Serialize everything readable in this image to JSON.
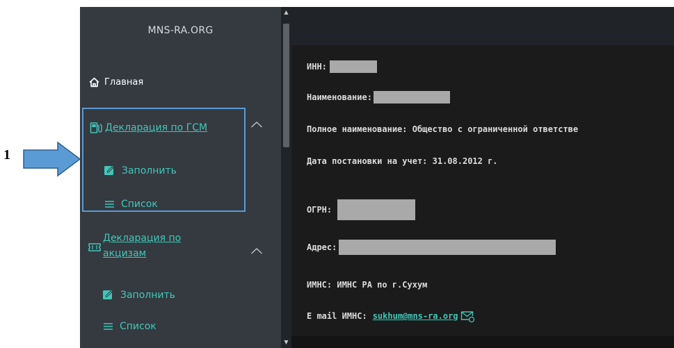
{
  "annotation": {
    "number": "1"
  },
  "sidebar": {
    "logo": "MNS-RA.ORG",
    "home_label": "Главная",
    "gsm": {
      "label": "Декларация по ГСМ",
      "fill_label": "Заполнить",
      "list_label": "Список"
    },
    "excise": {
      "label_line1": "Декларация по",
      "label_line2": "акцизам",
      "fill_label": "Заполнить",
      "list_label": "Список"
    }
  },
  "main": {
    "inn_label": "ИНН:",
    "name_label": "Наименование:",
    "full_name": "Полное наименование: Общество с ограниченной ответстве",
    "reg_date": "Дата постановки на учет: 31.08.2012 г.",
    "ogrn_label": "ОГРН:",
    "address_label": "Адрес:",
    "imns": "ИМНС: ИМНС РА по г.Сухум",
    "email_label": "E mail ИМНС:",
    "email_value": "sukhum@mns-ra.org"
  },
  "colors": {
    "accent": "#41c7b9",
    "sidebar_bg": "#343a40",
    "highlight_border": "#5b9bd5"
  }
}
